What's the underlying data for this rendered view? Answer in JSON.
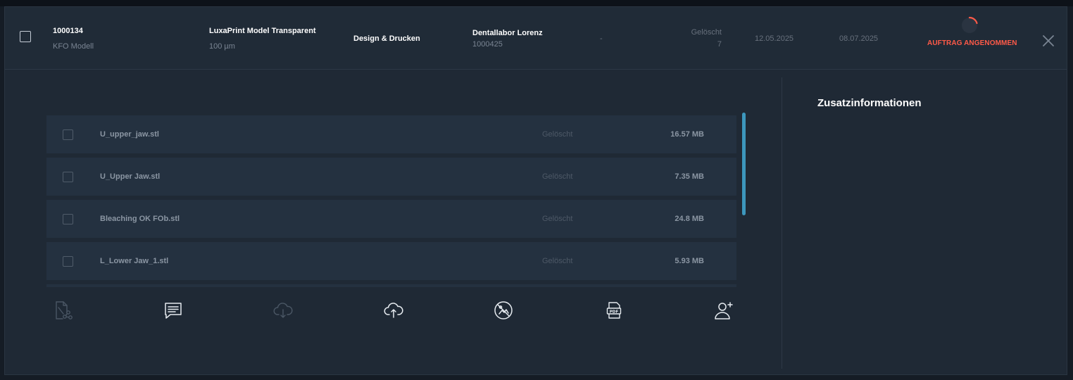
{
  "order": {
    "id": "1000134",
    "type": "KFO Modell",
    "material": "LuxaPrint Model Transparent",
    "layer": "100 µm",
    "service": "Design & Drucken",
    "customer_name": "Dentallabor Lorenz",
    "customer_id": "1000425",
    "placeholder": "-",
    "deleted_label": "Gelöscht",
    "deleted_count": "7",
    "date_created": "12.05.2025",
    "date_due": "08.07.2025",
    "status": "AUFTRAG ANGENOMMEN",
    "status_color": "#ff5a48"
  },
  "info": {
    "title": "Zusatzinformationen"
  },
  "files": [
    {
      "name": "U_upper_jaw.stl",
      "status": "Gelöscht",
      "size": "16.57 MB"
    },
    {
      "name": "U_Upper Jaw.stl",
      "status": "Gelöscht",
      "size": "7.35 MB"
    },
    {
      "name": "Bleaching OK FOb.stl",
      "status": "Gelöscht",
      "size": "24.8 MB"
    },
    {
      "name": "L_Lower Jaw_1.stl",
      "status": "Gelöscht",
      "size": "5.93 MB"
    }
  ],
  "toolbar": [
    {
      "icon": "file-share-icon",
      "enabled": false
    },
    {
      "icon": "chat-icon",
      "enabled": true
    },
    {
      "icon": "cloud-download-icon",
      "enabled": false
    },
    {
      "icon": "cloud-upload-icon",
      "enabled": true
    },
    {
      "icon": "no-image-icon",
      "enabled": true
    },
    {
      "icon": "pdf-icon",
      "enabled": true
    },
    {
      "icon": "add-user-icon",
      "enabled": true
    }
  ],
  "colors": {
    "accent": "#3d97bd",
    "background": "#1f2935"
  }
}
